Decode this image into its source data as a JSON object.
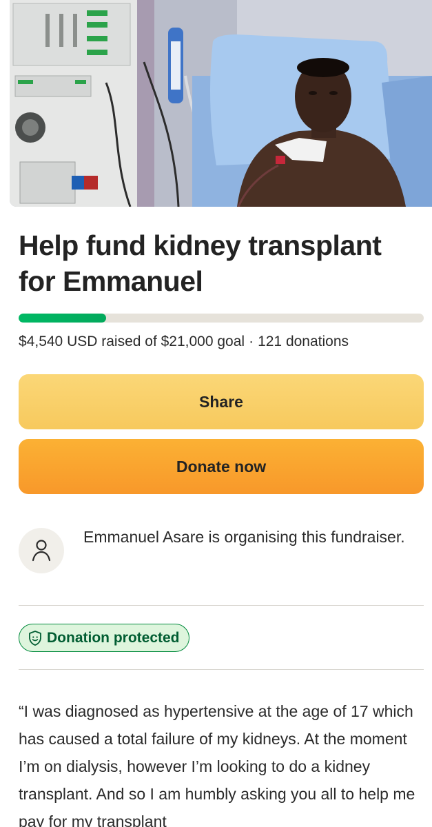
{
  "hero": {
    "image": "photo-of-patient-in-hospital-bed-beside-dialysis-machine"
  },
  "campaign": {
    "title": "Help fund kidney transplant for Emmanuel",
    "progress_fraction": 0.216,
    "raised_text": "$4,540 USD raised of $21,000 goal",
    "separator": "·",
    "donations_text": "121 donations"
  },
  "actions": {
    "share_label": "Share",
    "donate_label": "Donate now"
  },
  "organiser": {
    "icon": "person-icon",
    "text": "Emmanuel Asare is organising this fundraiser."
  },
  "protection": {
    "icon": "shield-icon",
    "label": "Donation protected"
  },
  "story": {
    "text": "“I was diagnosed as hypertensive at the age of 17 which has caused a total failure of my kidneys. At the moment I’m on dialysis, however I’m looking to do a kidney transplant. And so I am humbly asking you all to help me pay for my transplant"
  },
  "colors": {
    "progress": "#02a95c",
    "share_button": "#f9cf68",
    "donate_button": "#f9a42f",
    "badge_border": "#028a3d",
    "badge_bg": "#def5dd"
  }
}
